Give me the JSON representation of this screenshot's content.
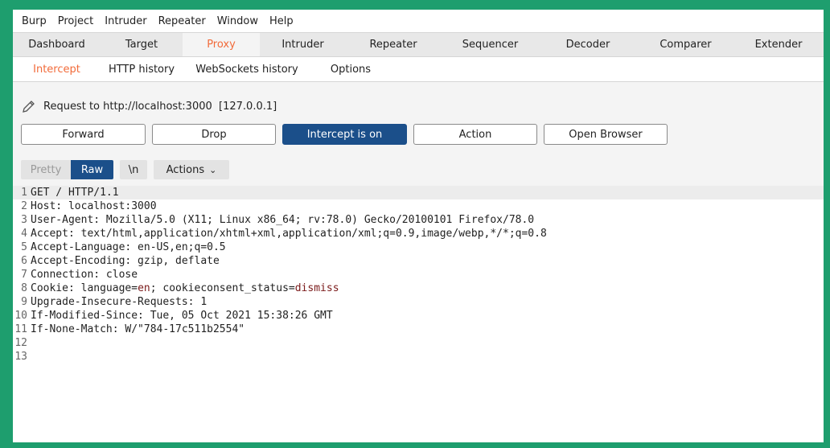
{
  "menubar": {
    "items": [
      {
        "label": "Burp"
      },
      {
        "label": "Project"
      },
      {
        "label": "Intruder"
      },
      {
        "label": "Repeater"
      },
      {
        "label": "Window"
      },
      {
        "label": "Help"
      }
    ]
  },
  "main_tabs": [
    {
      "label": "Dashboard"
    },
    {
      "label": "Target"
    },
    {
      "label": "Proxy",
      "active": true
    },
    {
      "label": "Intruder"
    },
    {
      "label": "Repeater"
    },
    {
      "label": "Sequencer"
    },
    {
      "label": "Decoder"
    },
    {
      "label": "Comparer"
    },
    {
      "label": "Extender"
    }
  ],
  "sub_tabs": [
    {
      "label": "Intercept",
      "active": true
    },
    {
      "label": "HTTP history"
    },
    {
      "label": "WebSockets history"
    },
    {
      "label": "Options"
    }
  ],
  "intercept": {
    "request_label": "Request to http://localhost:3000  [127.0.0.1]",
    "buttons": {
      "forward": "Forward",
      "drop": "Drop",
      "intercept": "Intercept is on",
      "action": "Action",
      "open_browser": "Open Browser"
    }
  },
  "editor_toolbar": {
    "pretty": "Pretty",
    "raw": "Raw",
    "newline": "\\n",
    "actions": "Actions"
  },
  "editor": {
    "lines": [
      {
        "num": "1",
        "text": "GET / HTTP/1.1"
      },
      {
        "num": "2",
        "text": "Host: localhost:3000"
      },
      {
        "num": "3",
        "text": "User-Agent: Mozilla/5.0 (X11; Linux x86_64; rv:78.0) Gecko/20100101 Firefox/78.0"
      },
      {
        "num": "4",
        "text": "Accept: text/html,application/xhtml+xml,application/xml;q=0.9,image/webp,*/*;q=0.8"
      },
      {
        "num": "5",
        "text": "Accept-Language: en-US,en;q=0.5"
      },
      {
        "num": "6",
        "text": "Accept-Encoding: gzip, deflate"
      },
      {
        "num": "7",
        "text": "Connection: close"
      },
      {
        "num": "8",
        "text_prefix": "Cookie: language=",
        "val1": "en",
        "text_mid": "; cookieconsent_status=",
        "val2": "dismiss"
      },
      {
        "num": "9",
        "text": "Upgrade-Insecure-Requests: 1"
      },
      {
        "num": "10",
        "text": "If-Modified-Since: Tue, 05 Oct 2021 15:38:26 GMT"
      },
      {
        "num": "11",
        "text": "If-None-Match: W/\"784-17c511b2554\""
      },
      {
        "num": "12",
        "text": ""
      },
      {
        "num": "13",
        "text": ""
      }
    ]
  },
  "colors": {
    "accent_orange": "#f26b3a",
    "intercept_blue": "#1b4f8a",
    "frame_green": "#1e9e6e",
    "cookie_value": "#7a1a1a"
  }
}
